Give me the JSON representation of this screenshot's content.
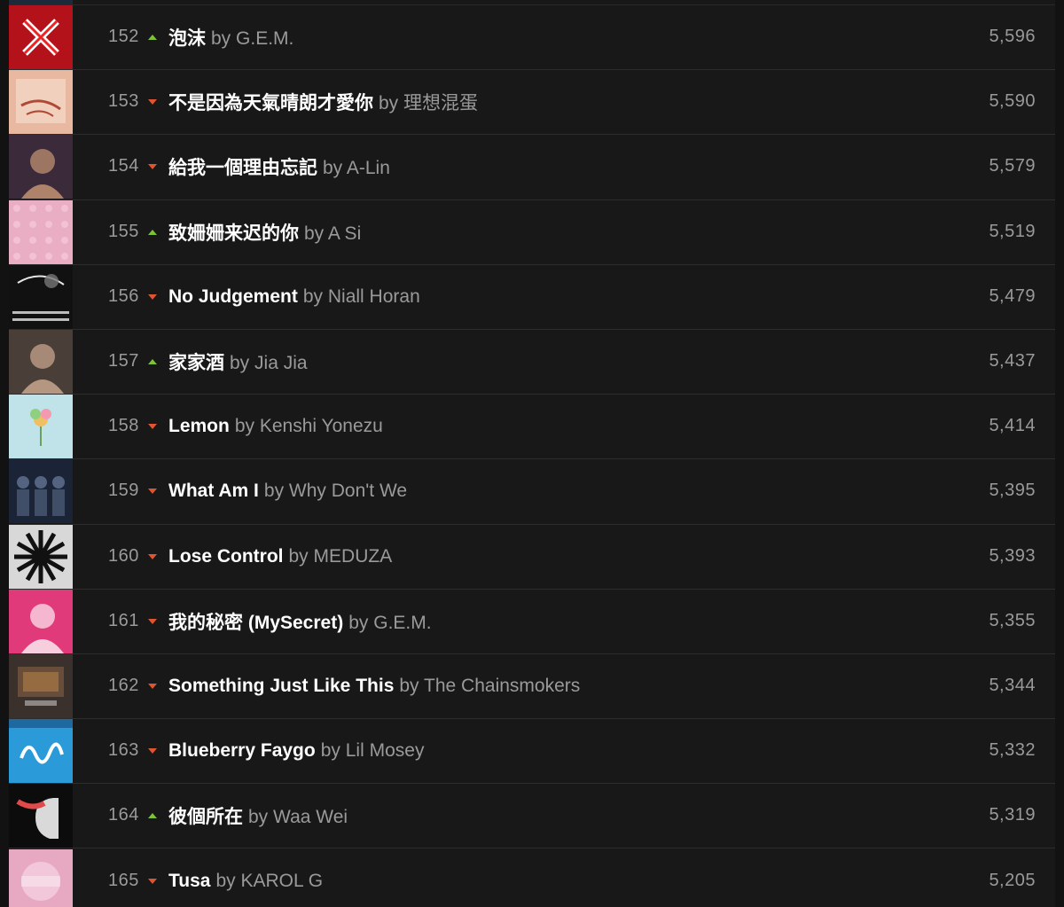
{
  "colors": {
    "background": "#121212",
    "row_background": "#181818",
    "track_title": "#ffffff",
    "secondary_text": "#9a9a9a",
    "trend_up": "#7ec23a",
    "trend_down": "#e0542f"
  },
  "by_label": "by",
  "rows": [
    {
      "rank": "152",
      "trend": "up",
      "title": "泡沫",
      "artist": "G.E.M.",
      "streams": "5,596",
      "art": {
        "bg": "#b3121a",
        "fg": "#ffffff",
        "motif": "x-mark"
      }
    },
    {
      "rank": "153",
      "trend": "down",
      "title": "不是因為天氣晴朗才愛你",
      "artist": "理想混蛋",
      "streams": "5,590",
      "art": {
        "bg": "#e8b8a0",
        "fg": "#b04a38",
        "motif": "paper"
      }
    },
    {
      "rank": "154",
      "trend": "down",
      "title": "給我一個理由忘記",
      "artist": "A-Lin",
      "streams": "5,579",
      "art": {
        "bg": "#3a2a3a",
        "fg": "#d4a07a",
        "motif": "portrait"
      }
    },
    {
      "rank": "155",
      "trend": "up",
      "title": "致姍姍来迟的你",
      "artist": "A Si",
      "streams": "5,519",
      "art": {
        "bg": "#e9aec4",
        "fg": "#f5cbd9",
        "motif": "pattern"
      }
    },
    {
      "rank": "156",
      "trend": "down",
      "title": "No Judgement",
      "artist": "Niall Horan",
      "streams": "5,479",
      "art": {
        "bg": "#111111",
        "fg": "#e6e6e6",
        "motif": "text-art"
      }
    },
    {
      "rank": "157",
      "trend": "up",
      "title": "家家酒",
      "artist": "Jia Jia",
      "streams": "5,437",
      "art": {
        "bg": "#4a3f38",
        "fg": "#d9b49a",
        "motif": "portrait"
      }
    },
    {
      "rank": "158",
      "trend": "down",
      "title": "Lemon",
      "artist": "Kenshi Yonezu",
      "streams": "5,414",
      "art": {
        "bg": "#bfe3e8",
        "fg": "#f0c060",
        "motif": "flower"
      }
    },
    {
      "rank": "159",
      "trend": "down",
      "title": "What Am I",
      "artist": "Why Don't We",
      "streams": "5,395",
      "art": {
        "bg": "#1a2436",
        "fg": "#5a6a88",
        "motif": "group"
      }
    },
    {
      "rank": "160",
      "trend": "down",
      "title": "Lose Control",
      "artist": "MEDUZA",
      "streams": "5,393",
      "art": {
        "bg": "#d8d8d8",
        "fg": "#111111",
        "motif": "burst"
      }
    },
    {
      "rank": "161",
      "trend": "down",
      "title": "我的秘密 (MySecret)",
      "artist": "G.E.M.",
      "streams": "5,355",
      "art": {
        "bg": "#e03a7a",
        "fg": "#ffffff",
        "motif": "portrait"
      }
    },
    {
      "rank": "162",
      "trend": "down",
      "title": "Something Just Like This",
      "artist": "The Chainsmokers",
      "streams": "5,344",
      "art": {
        "bg": "#3a302c",
        "fg": "#7a5a40",
        "motif": "room"
      }
    },
    {
      "rank": "163",
      "trend": "down",
      "title": "Blueberry Faygo",
      "artist": "Lil Mosey",
      "streams": "5,332",
      "art": {
        "bg": "#2a9ad8",
        "fg": "#ffffff",
        "motif": "script"
      }
    },
    {
      "rank": "164",
      "trend": "up",
      "title": "彼個所在",
      "artist": "Waa Wei",
      "streams": "5,319",
      "art": {
        "bg": "#0c0c0c",
        "fg": "#e04a4a",
        "motif": "profile"
      }
    },
    {
      "rank": "165",
      "trend": "down",
      "title": "Tusa",
      "artist": "KAROL G",
      "streams": "5,205",
      "art": {
        "bg": "#e7a9c2",
        "fg": "#f7d4e2",
        "motif": "soft"
      }
    }
  ]
}
